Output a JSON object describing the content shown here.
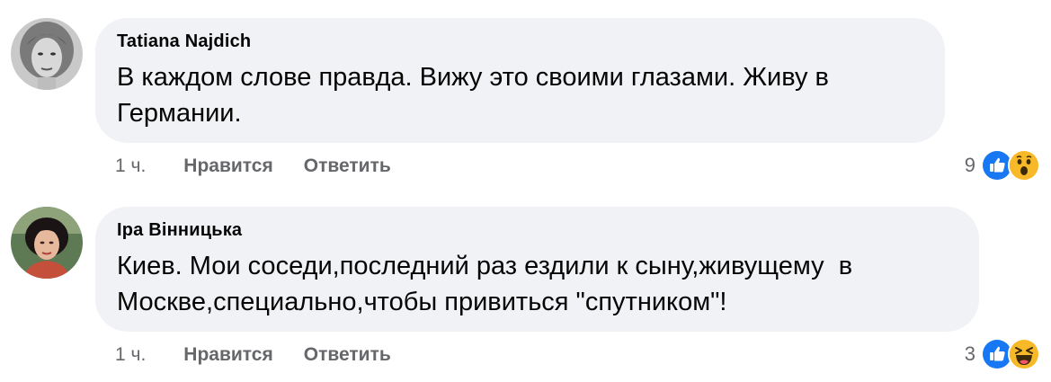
{
  "comments": [
    {
      "author": "Tatiana Najdich",
      "text": "В каждом слове правда. Вижу это своими глазами. Живу в\nГермании.",
      "time": "1 ч.",
      "like_label": "Нравится",
      "reply_label": "Ответить",
      "reaction_count": "9",
      "reactions": [
        "like-icon",
        "wow-icon"
      ]
    },
    {
      "author": "Іра Вінницька",
      "text": "Киев. Мои соседи,последний раз ездили к сыну,живущему  в\nМоскве,специально,чтобы привиться \"спутником\"!",
      "time": "1 ч.",
      "like_label": "Нравится",
      "reply_label": "Ответить",
      "reaction_count": "3",
      "reactions": [
        "like-icon",
        "haha-icon"
      ]
    }
  ],
  "colors": {
    "bubble": "#f0f2f5",
    "meta_text": "#65676b",
    "like_blue": "#1877f2",
    "emoji_yellow": "#f7b928"
  }
}
